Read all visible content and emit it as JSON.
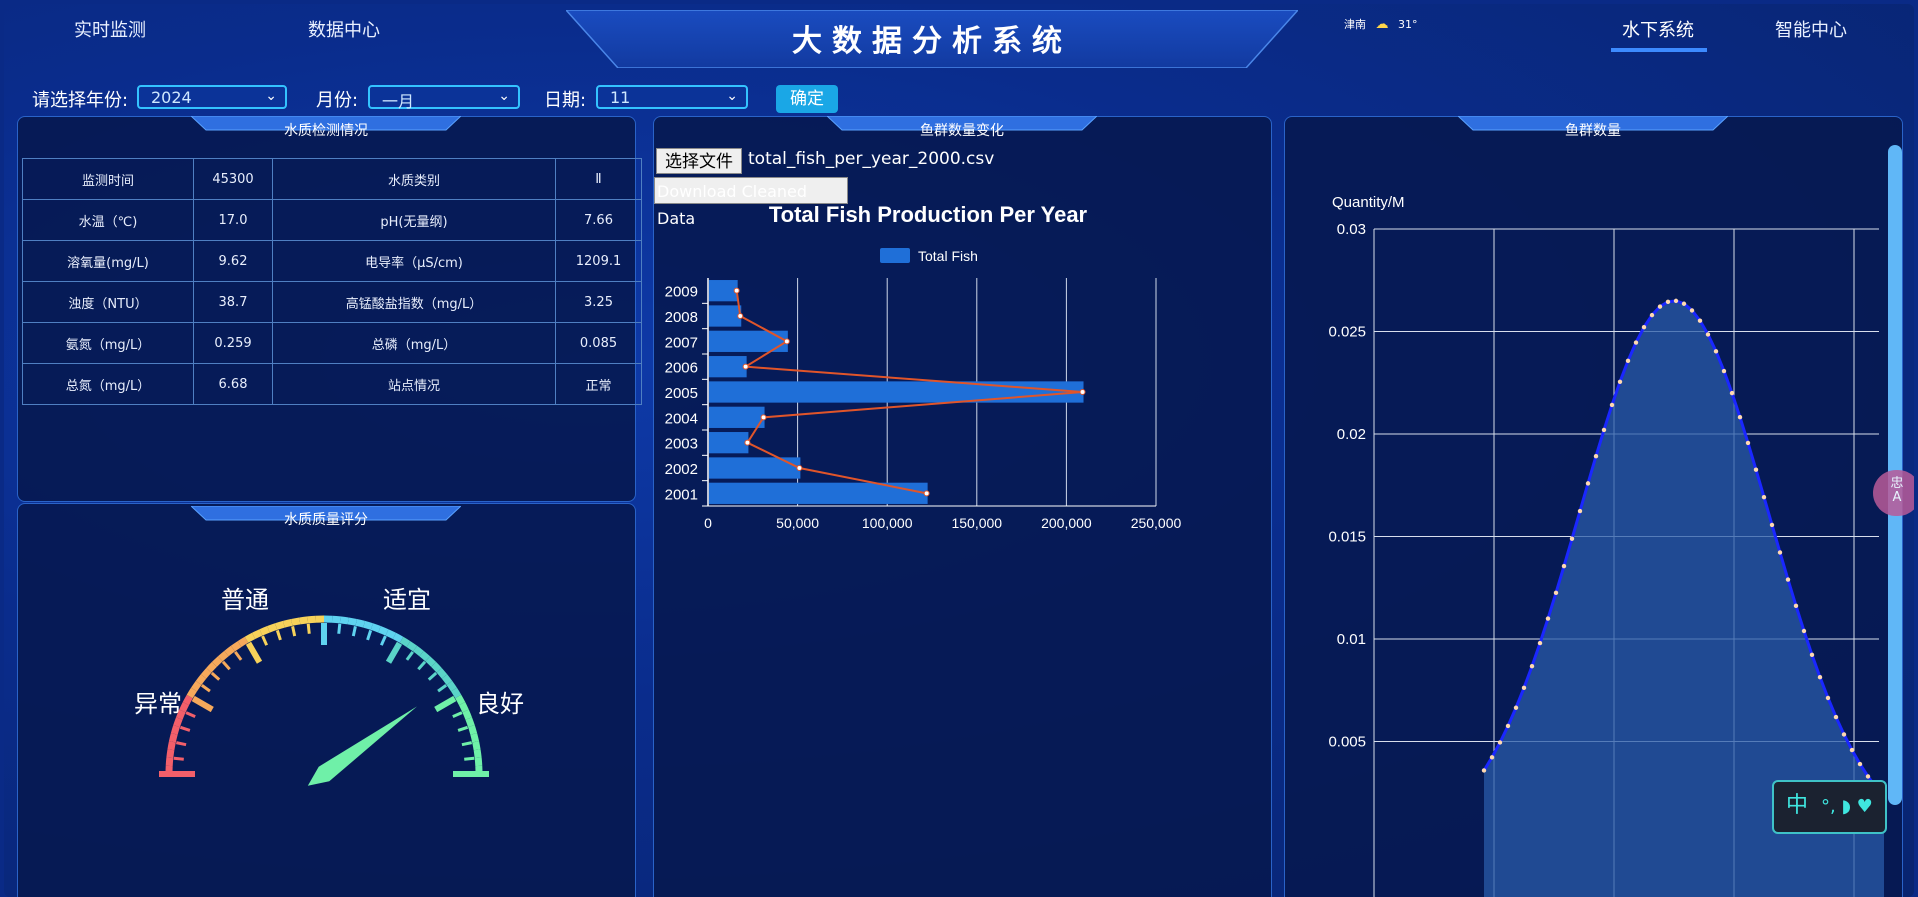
{
  "nav": {
    "left": [
      "实时监测",
      "数据中心"
    ],
    "right": [
      "水下系统",
      "智能中心"
    ],
    "active": "水下系统"
  },
  "title": "大数据分析系统",
  "weather": {
    "city": "津南",
    "temp": "31°",
    "icon": "weather-icon"
  },
  "controls": {
    "year_label": "请选择年份:",
    "year_value": "2024",
    "month_label": "月份:",
    "month_value": "一月",
    "day_label": "日期:",
    "day_value": "11",
    "confirm": "确定"
  },
  "water_panel": {
    "title": "水质检测情况",
    "rows": [
      [
        "监测时间",
        "45300",
        "水质类别",
        "Ⅱ"
      ],
      [
        "水温（℃)",
        "17.0",
        "pH(无量纲)",
        "7.66"
      ],
      [
        "溶氧量(mg/L)",
        "9.62",
        "电导率（μS/cm)",
        "1209.1"
      ],
      [
        "浊度（NTU）",
        "38.7",
        "高锰酸盐指数（mg/L）",
        "3.25"
      ],
      [
        "氨氮（mg/L）",
        "0.259",
        "总磷（mg/L）",
        "0.085"
      ],
      [
        "总氮（mg/L）",
        "6.68",
        "站点情况",
        "正常"
      ]
    ]
  },
  "gauge_panel": {
    "title": "水质质量评分",
    "labels": [
      "异常",
      "普通",
      "适宜",
      "良好"
    ],
    "needle_fraction": 0.8
  },
  "fish_change_panel": {
    "title": "鱼群数量变化",
    "file_button": "选择文件",
    "file_name": "total_fish_per_year_2000.csv",
    "download_button": "Download Cleaned Data"
  },
  "fish_count_panel": {
    "title": "鱼群数量"
  },
  "ime": {
    "text": "中"
  },
  "bubble": {
    "text": "忠\nA"
  },
  "chart_data": [
    {
      "type": "bar",
      "orientation": "horizontal",
      "title": "Total Fish Production Per Year",
      "legend": [
        "Total Fish"
      ],
      "categories": [
        "2001",
        "2002",
        "2003",
        "2004",
        "2005",
        "2006",
        "2007",
        "2008",
        "2009"
      ],
      "series": [
        {
          "name": "Total Fish",
          "values": [
            122000,
            51000,
            22000,
            31000,
            209000,
            21000,
            44000,
            18000,
            16000
          ]
        }
      ],
      "xlim": [
        0,
        250000
      ],
      "xticks": [
        "0",
        "50,000",
        "100,000",
        "150,000",
        "200,000",
        "250,000"
      ],
      "overlay_line": true,
      "colors": {
        "bar": "#1f6fd8",
        "line": "#e0552a"
      }
    },
    {
      "type": "area",
      "ylabel": "Quantity/M",
      "ylim": [
        0,
        0.03
      ],
      "yticks": [
        "0.005",
        "0.01",
        "0.015",
        "0.02",
        "0.025",
        "0.03"
      ],
      "peak_value": 0.0265,
      "shape": "bell curve",
      "grid": true,
      "colors": {
        "line": "#1a27ff",
        "fill": "#2a5ba8",
        "points": "#ffd9b0"
      }
    }
  ]
}
